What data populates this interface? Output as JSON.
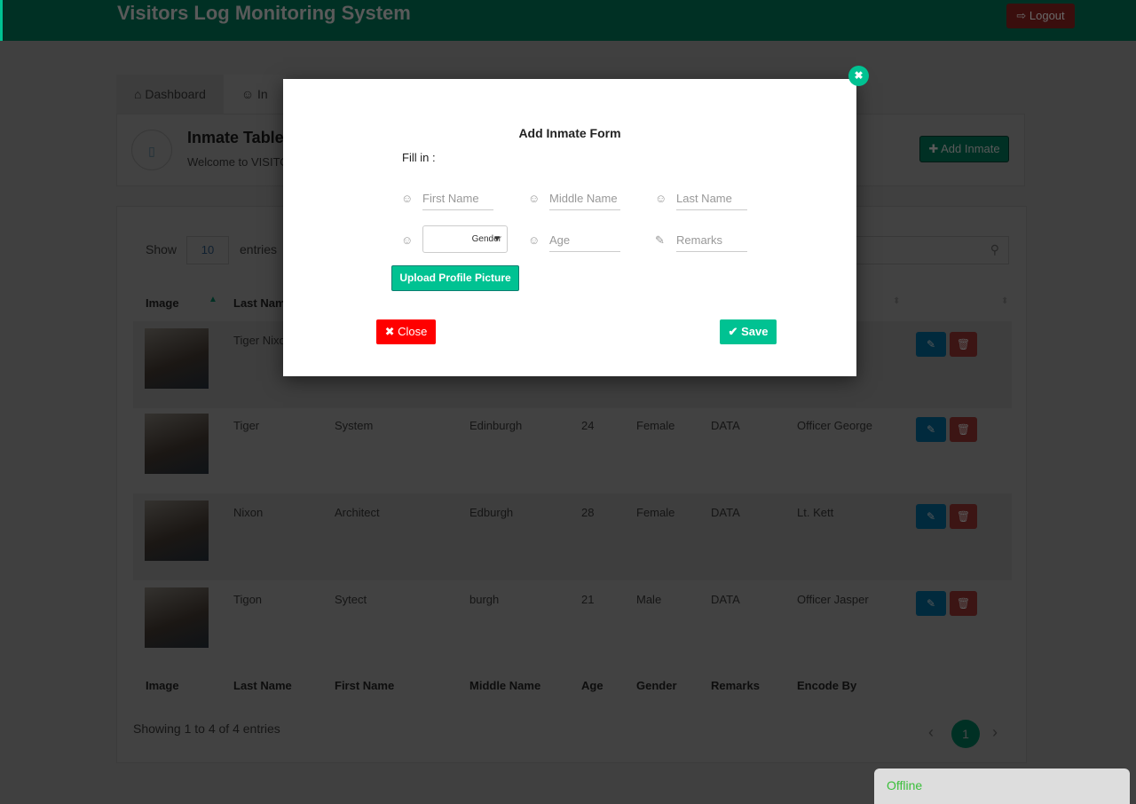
{
  "app": {
    "title": "Visitors Log Monitoring System",
    "logout": "Logout"
  },
  "tabs": [
    {
      "label": "Dashboard",
      "icon": "dashboard-icon"
    },
    {
      "label": "In",
      "icon": "inmate-icon"
    }
  ],
  "section": {
    "title": "Inmate Table",
    "welcome": "Welcome to VISITO",
    "add_button": "Add Inmate"
  },
  "table": {
    "show": "Show",
    "length": "10",
    "entries": "entries",
    "columns": [
      "Image",
      "Last Name",
      "First Name",
      "Middle Name",
      "Age",
      "Gender",
      "Remarks",
      "Encode By"
    ],
    "rows": [
      {
        "last": "Tiger Nixon",
        "first": "",
        "middle": "",
        "age": "",
        "gender": "",
        "remarks": "",
        "encode": ""
      },
      {
        "last": "Tiger",
        "first": "System",
        "middle": "Edinburgh",
        "age": "24",
        "gender": "Female",
        "remarks": "DATA",
        "encode": "Officer George"
      },
      {
        "last": "Nixon",
        "first": "Architect",
        "middle": "Edburgh",
        "age": "28",
        "gender": "Female",
        "remarks": "DATA",
        "encode": "Lt. Kett"
      },
      {
        "last": "Tigon",
        "first": "Sytect",
        "middle": "burgh",
        "age": "21",
        "gender": "Male",
        "remarks": "DATA",
        "encode": "Officer Jasper"
      }
    ],
    "info": "Showing 1 to 4 of 4 entries",
    "page": "1"
  },
  "modal": {
    "title": "Add Inmate Form",
    "fill_in": "Fill in :",
    "first_name": "First Name",
    "middle_name": "Middle Name",
    "last_name": "Last Name",
    "gender": "Gender",
    "age": "Age",
    "remarks": "Remarks",
    "upload": "Upload Profile Picture",
    "close": "Close",
    "save": "Save"
  },
  "status": {
    "label": "Offline",
    "color": "#3bbf3b"
  },
  "colors": {
    "primary": "#00c292",
    "danger": "#ff0000",
    "info": "#03a9f3"
  }
}
